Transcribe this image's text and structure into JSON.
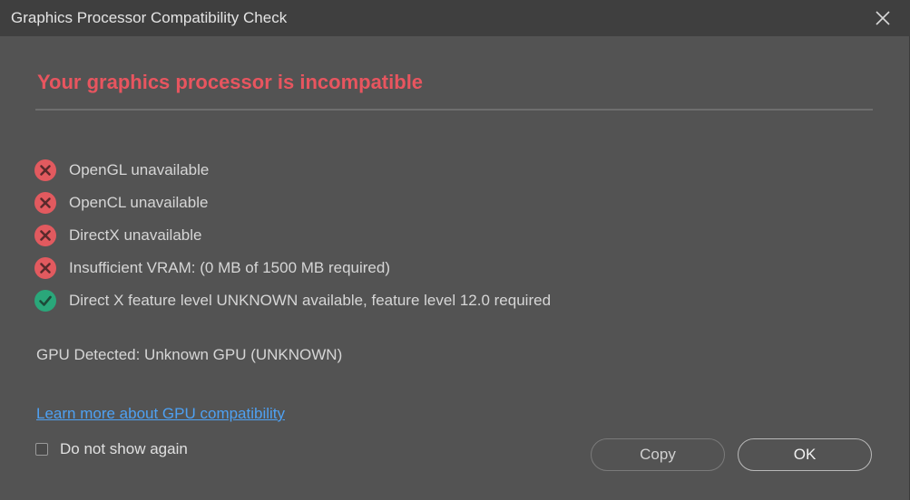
{
  "window": {
    "title": "Graphics Processor Compatibility Check"
  },
  "heading": "Your graphics processor is incompatible",
  "checks": [
    {
      "label": "OpenGL unavailable",
      "status": "fail",
      "icon": "x-circle-icon"
    },
    {
      "label": "OpenCL unavailable",
      "status": "fail",
      "icon": "x-circle-icon"
    },
    {
      "label": "DirectX unavailable",
      "status": "fail",
      "icon": "x-circle-icon"
    },
    {
      "label": "Insufficient VRAM: (0 MB of 1500 MB required)",
      "status": "fail",
      "icon": "x-circle-icon"
    },
    {
      "label": "Direct X feature level UNKNOWN available, feature level 12.0 required",
      "status": "pass",
      "icon": "check-circle-icon"
    }
  ],
  "gpu_detected": "GPU Detected: Unknown GPU (UNKNOWN)",
  "learn_more_link": "Learn more about GPU compatibility",
  "dont_show_again": {
    "label": "Do not show again",
    "checked": false
  },
  "buttons": {
    "copy_label": "Copy",
    "ok_label": "OK"
  },
  "colors": {
    "heading": "#e8555f",
    "fail_icon": "#e25a5f",
    "pass_icon": "#2aa77a",
    "link": "#4ea1f3",
    "background": "#535353",
    "titlebar": "#3f3f3f"
  }
}
